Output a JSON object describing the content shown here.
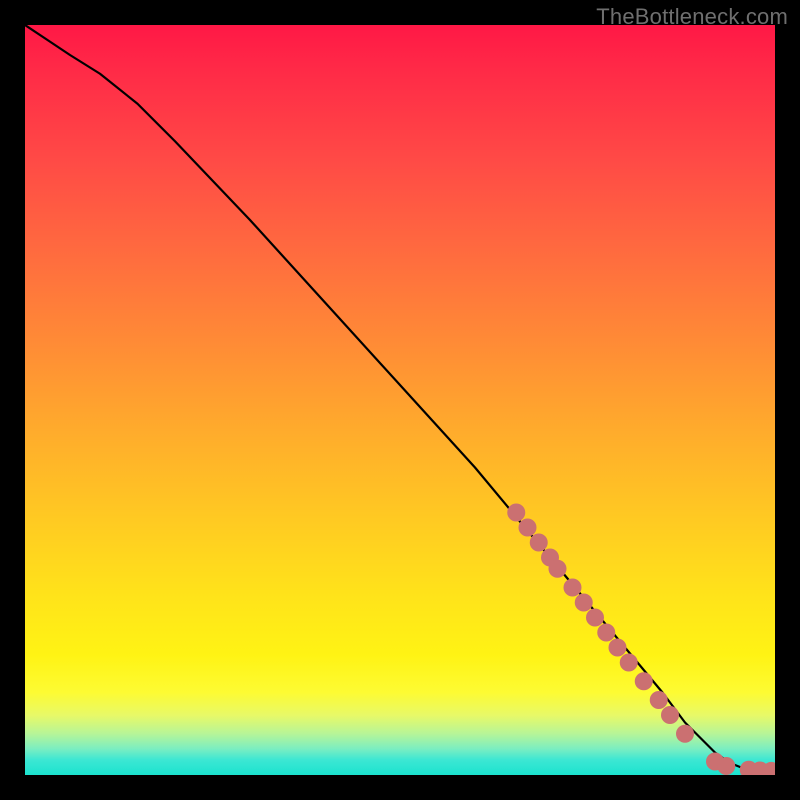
{
  "watermark": "TheBottleneck.com",
  "colors": {
    "background": "#000000",
    "curve": "#000000",
    "marker_fill": "#cb7071",
    "marker_stroke": "#b85c5d"
  },
  "chart_data": {
    "type": "line",
    "title": "",
    "xlabel": "",
    "ylabel": "",
    "xlim": [
      0,
      100
    ],
    "ylim": [
      0,
      100
    ],
    "grid": false,
    "legend": false,
    "series": [
      {
        "name": "bottleneck-curve",
        "x": [
          0,
          3,
          6,
          10,
          15,
          20,
          30,
          40,
          50,
          60,
          65,
          70,
          75,
          80,
          85,
          88,
          90,
          92,
          94,
          96,
          98,
          99,
          100
        ],
        "y": [
          100,
          98,
          96,
          93.5,
          89.5,
          84.5,
          74,
          63,
          52,
          41,
          35,
          29,
          23,
          17,
          11,
          7,
          5,
          3,
          1.6,
          0.8,
          0.6,
          0.55,
          0.5
        ]
      }
    ],
    "markers": [
      {
        "x": 65.5,
        "y": 35.0
      },
      {
        "x": 67.0,
        "y": 33.0
      },
      {
        "x": 68.5,
        "y": 31.0
      },
      {
        "x": 70.0,
        "y": 29.0
      },
      {
        "x": 71.0,
        "y": 27.5
      },
      {
        "x": 73.0,
        "y": 25.0
      },
      {
        "x": 74.5,
        "y": 23.0
      },
      {
        "x": 76.0,
        "y": 21.0
      },
      {
        "x": 77.5,
        "y": 19.0
      },
      {
        "x": 79.0,
        "y": 17.0
      },
      {
        "x": 80.5,
        "y": 15.0
      },
      {
        "x": 82.5,
        "y": 12.5
      },
      {
        "x": 84.5,
        "y": 10.0
      },
      {
        "x": 86.0,
        "y": 8.0
      },
      {
        "x": 88.0,
        "y": 5.5
      },
      {
        "x": 92.0,
        "y": 1.8
      },
      {
        "x": 93.5,
        "y": 1.2
      },
      {
        "x": 96.5,
        "y": 0.7
      },
      {
        "x": 98.0,
        "y": 0.6
      },
      {
        "x": 99.5,
        "y": 0.55
      }
    ]
  }
}
